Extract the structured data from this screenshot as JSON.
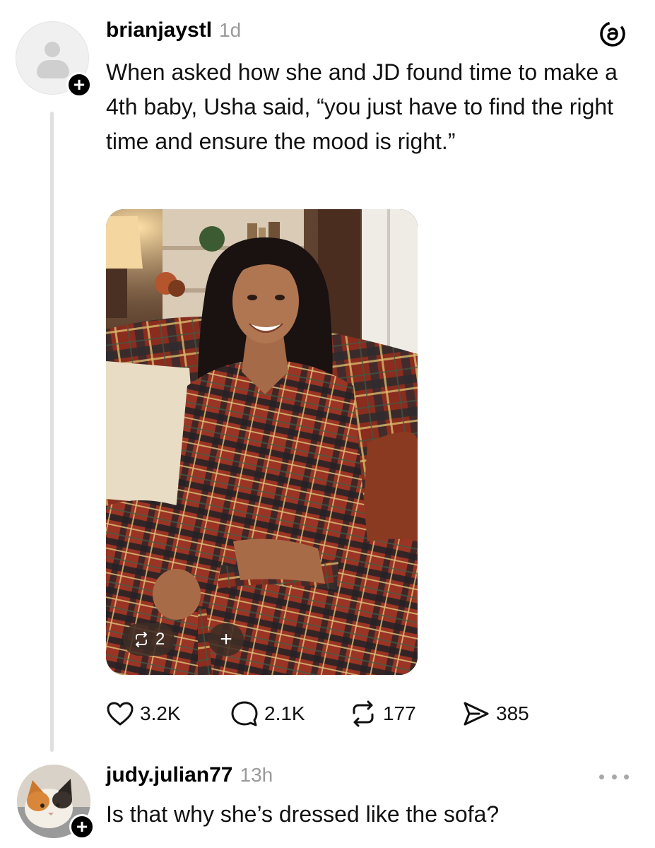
{
  "post": {
    "username": "brianjaystl",
    "time": "1d",
    "text": "When asked how she and JD found time to make a 4th baby, Usha said, “you just have to find the right time and ensure the mood is right.”",
    "follow_symbol": "+",
    "image": {
      "repost_count": "2",
      "add_symbol": "+"
    },
    "stats": {
      "likes": "3.2K",
      "replies": "2.1K",
      "reposts": "177",
      "shares": "385"
    },
    "icons": [
      "threads-logo-icon",
      "heart-icon",
      "comment-icon",
      "repost-icon",
      "share-icon"
    ]
  },
  "reply": {
    "username": "judy.julian77",
    "time": "13h",
    "text": "Is that why she’s dressed like the sofa?",
    "follow_symbol": "+",
    "icons": [
      "more-icon"
    ]
  }
}
